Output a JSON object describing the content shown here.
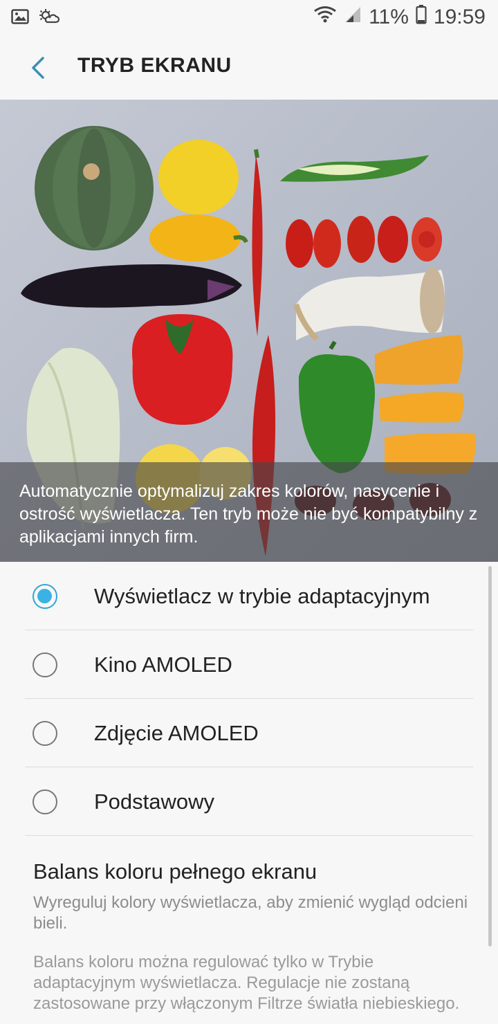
{
  "status_bar": {
    "battery_percent": "11%",
    "time": "19:59",
    "icons": [
      "gallery-icon",
      "weather-icon",
      "wifi-icon",
      "signal-icon",
      "battery-icon"
    ]
  },
  "app_bar": {
    "title": "TRYB EKRANU",
    "back_icon": "back-arrow-icon"
  },
  "preview": {
    "caption": "Automatycznie optymalizuj zakres kolorów, nasycenie i ostrość wyświetlacza. Ten tryb może nie być kompatybilny z aplikacjami innych firm."
  },
  "options": [
    {
      "label": "Wyświetlacz w trybie adaptacyjnym",
      "selected": true
    },
    {
      "label": "Kino AMOLED",
      "selected": false
    },
    {
      "label": "Zdjęcie AMOLED",
      "selected": false
    },
    {
      "label": "Podstawowy",
      "selected": false
    }
  ],
  "balance": {
    "title": "Balans koloru pełnego ekranu",
    "subtitle": "Wyreguluj kolory wyświetlacza, aby zmienić wygląd odcieni bieli."
  },
  "note": "Balans koloru można regulować tylko w Trybie adaptacyjnym wyświetlacza. Regulacje nie zostaną zastosowane przy włączonym Filtrze światła niebieskiego.",
  "colors": {
    "accent": "#3ab2e3",
    "background": "#f7f7f7"
  }
}
